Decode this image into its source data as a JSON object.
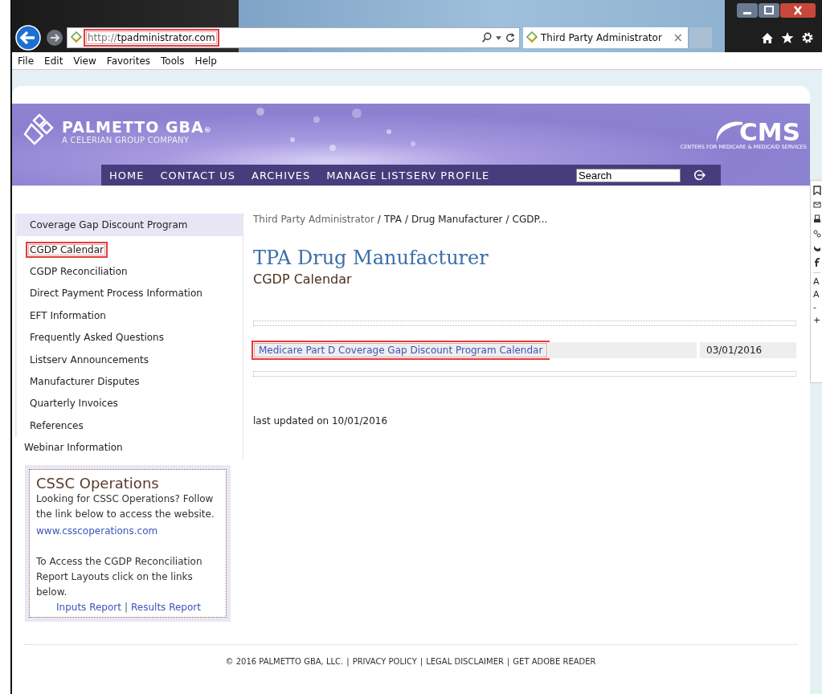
{
  "browser": {
    "address": {
      "prefix": "http://",
      "domain": "tpadministrator.com",
      "highlighted": true
    },
    "tab": {
      "title": "Third Party Administrator",
      "close": "×"
    },
    "menu": [
      "File",
      "Edit",
      "View",
      "Favorites",
      "Tools",
      "Help"
    ]
  },
  "header": {
    "logo": {
      "name": "PALMETTO GBA",
      "mark": "®",
      "tagline": "A CELERIAN GROUP COMPANY"
    },
    "cms": {
      "name": "CMS",
      "tagline": "CENTERS FOR MEDICARE & MEDICAID SERVICES"
    },
    "nav": [
      "HOME",
      "CONTACT US",
      "ARCHIVES",
      "MANAGE LISTSERV PROFILE"
    ],
    "search": {
      "value": "Search"
    }
  },
  "sidebar": {
    "items": [
      {
        "label": "Coverage Gap Discount Program",
        "highlighted": false,
        "children": [
          {
            "label": "CGDP Calendar",
            "highlighted": true
          },
          {
            "label": "CGDP Reconciliation",
            "highlighted": false
          },
          {
            "label": "Direct Payment Process Information",
            "highlighted": false
          },
          {
            "label": "EFT Information",
            "highlighted": false
          },
          {
            "label": "Frequently Asked Questions",
            "highlighted": false
          },
          {
            "label": "Listserv Announcements",
            "highlighted": false
          },
          {
            "label": "Manufacturer Disputes",
            "highlighted": false
          },
          {
            "label": "Quarterly Invoices",
            "highlighted": false
          },
          {
            "label": "References",
            "highlighted": false
          }
        ]
      },
      {
        "label": "Webinar Information",
        "highlighted": false
      }
    ]
  },
  "cssc_box": {
    "title": "CSSC Operations",
    "text": "Looking for CSSC Operations? Follow the link below to access the website.",
    "link": "www.csscoperations.com",
    "text_2": "To Access the CGDP Reconciliation Report Layouts click on the links below.",
    "links": [
      "Inputs Report",
      "Results Report"
    ],
    "separator": "|"
  },
  "breadcrumb": {
    "items": [
      {
        "label": "Third Party Administrator",
        "kind": "link"
      },
      {
        "label": "TPA",
        "kind": "text"
      },
      {
        "label": "Drug Manufacturer",
        "kind": "text"
      },
      {
        "label": "CGDP...",
        "kind": "text"
      }
    ],
    "separator": "/"
  },
  "content": {
    "title": "TPA Drug Manufacturer",
    "subtitle": "CGDP Calendar",
    "documents": [
      {
        "title": "Medicare Part D Coverage Gap Discount Program Calendar",
        "date": "03/01/2016",
        "highlighted": true
      }
    ],
    "updated": "last updated on 10/01/2016"
  },
  "footer": {
    "items": [
      "© 2016 PALMETTO GBA, LLC.",
      "PRIVACY POLICY",
      "LEGAL DISCLAIMER",
      "GET ADOBE READER"
    ],
    "separator": "|"
  },
  "side_tools": {
    "text_sizes": [
      "A",
      "A",
      "-",
      "+"
    ]
  }
}
